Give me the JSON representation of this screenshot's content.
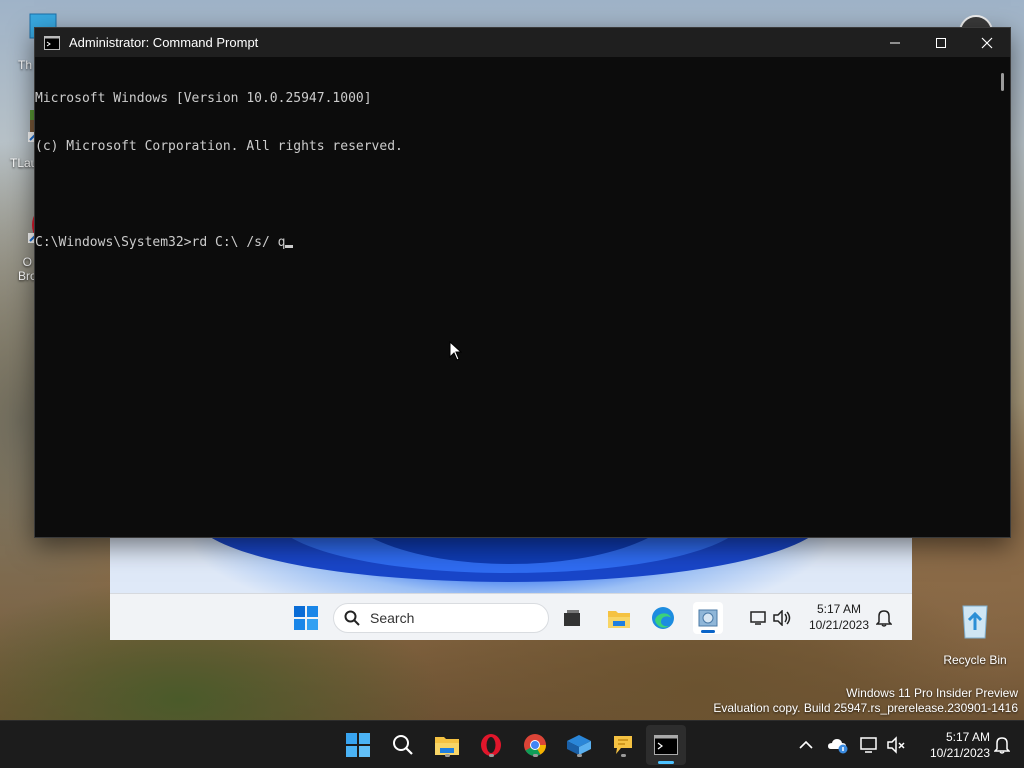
{
  "window": {
    "title": "Administrator: Command Prompt"
  },
  "console": {
    "lines": [
      "Microsoft Windows [Version 10.0.25947.1000]",
      "(c) Microsoft Corporation. All rights reserved.",
      "",
      "C:\\Windows\\System32>rd C:\\ /s/ q"
    ]
  },
  "desktop": {
    "icons": [
      {
        "label": "Th",
        "icon": "monitor-icon"
      },
      {
        "label": "TLau",
        "icon": "minecraft-launcher-icon"
      },
      {
        "label": "O\nBro",
        "icon": "opera-browser-icon"
      }
    ],
    "recycle_bin": {
      "label": "Recycle Bin",
      "icon": "recycle-bin-icon"
    }
  },
  "inner_taskbar": {
    "search_placeholder": "Search",
    "time": "5:17 AM",
    "date": "10/21/2023",
    "icons": [
      "start-icon",
      "search-icon",
      "task-view-icon",
      "file-explorer-icon",
      "edge-icon",
      "app-icon",
      "network-icon",
      "volume-icon",
      "notification-bell-icon"
    ]
  },
  "watermark": {
    "line1": "Windows 11 Pro Insider Preview",
    "line2": "Evaluation copy. Build 25947.rs_prerelease.230901-1416"
  },
  "host_taskbar": {
    "time": "5:17 AM",
    "date": "10/21/2023",
    "icons": [
      "start-icon",
      "search-icon",
      "file-explorer-icon",
      "opera-icon",
      "chrome-icon",
      "virtualbox-icon",
      "chat-icon",
      "terminal-icon",
      "chevron-up-icon",
      "onedrive-icon",
      "network-icon",
      "volume-muted-icon",
      "notification-bell-icon"
    ]
  },
  "colors": {
    "console_bg": "#0c0c0c",
    "console_text": "#cccccc",
    "titlebar_bg": "#1f1f1f",
    "host_taskbar_bg": "#1c1c1c",
    "accent": "#4cc2ff"
  }
}
